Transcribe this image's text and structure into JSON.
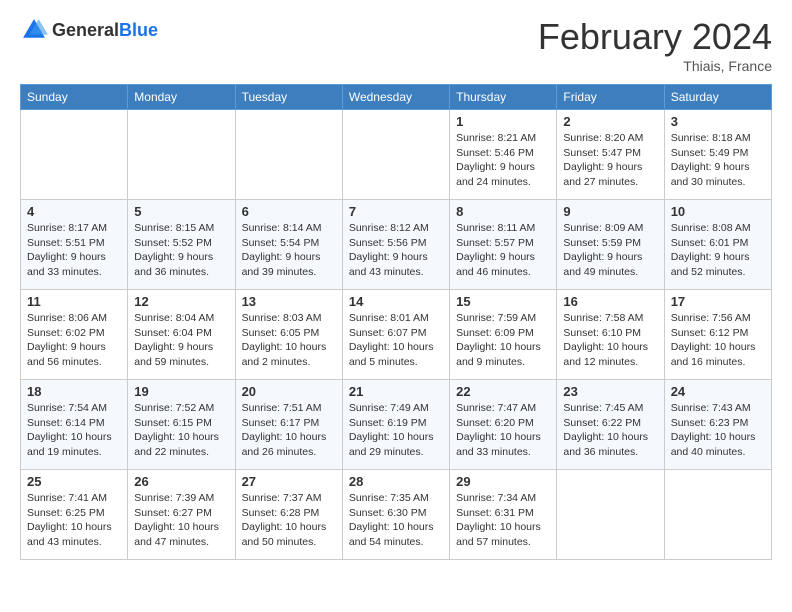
{
  "header": {
    "logo_general": "General",
    "logo_blue": "Blue",
    "month_title": "February 2024",
    "location": "Thiais, France"
  },
  "weekdays": [
    "Sunday",
    "Monday",
    "Tuesday",
    "Wednesday",
    "Thursday",
    "Friday",
    "Saturday"
  ],
  "weeks": [
    [
      {
        "day": "",
        "info": ""
      },
      {
        "day": "",
        "info": ""
      },
      {
        "day": "",
        "info": ""
      },
      {
        "day": "",
        "info": ""
      },
      {
        "day": "1",
        "info": "Sunrise: 8:21 AM\nSunset: 5:46 PM\nDaylight: 9 hours\nand 24 minutes."
      },
      {
        "day": "2",
        "info": "Sunrise: 8:20 AM\nSunset: 5:47 PM\nDaylight: 9 hours\nand 27 minutes."
      },
      {
        "day": "3",
        "info": "Sunrise: 8:18 AM\nSunset: 5:49 PM\nDaylight: 9 hours\nand 30 minutes."
      }
    ],
    [
      {
        "day": "4",
        "info": "Sunrise: 8:17 AM\nSunset: 5:51 PM\nDaylight: 9 hours\nand 33 minutes."
      },
      {
        "day": "5",
        "info": "Sunrise: 8:15 AM\nSunset: 5:52 PM\nDaylight: 9 hours\nand 36 minutes."
      },
      {
        "day": "6",
        "info": "Sunrise: 8:14 AM\nSunset: 5:54 PM\nDaylight: 9 hours\nand 39 minutes."
      },
      {
        "day": "7",
        "info": "Sunrise: 8:12 AM\nSunset: 5:56 PM\nDaylight: 9 hours\nand 43 minutes."
      },
      {
        "day": "8",
        "info": "Sunrise: 8:11 AM\nSunset: 5:57 PM\nDaylight: 9 hours\nand 46 minutes."
      },
      {
        "day": "9",
        "info": "Sunrise: 8:09 AM\nSunset: 5:59 PM\nDaylight: 9 hours\nand 49 minutes."
      },
      {
        "day": "10",
        "info": "Sunrise: 8:08 AM\nSunset: 6:01 PM\nDaylight: 9 hours\nand 52 minutes."
      }
    ],
    [
      {
        "day": "11",
        "info": "Sunrise: 8:06 AM\nSunset: 6:02 PM\nDaylight: 9 hours\nand 56 minutes."
      },
      {
        "day": "12",
        "info": "Sunrise: 8:04 AM\nSunset: 6:04 PM\nDaylight: 9 hours\nand 59 minutes."
      },
      {
        "day": "13",
        "info": "Sunrise: 8:03 AM\nSunset: 6:05 PM\nDaylight: 10 hours\nand 2 minutes."
      },
      {
        "day": "14",
        "info": "Sunrise: 8:01 AM\nSunset: 6:07 PM\nDaylight: 10 hours\nand 5 minutes."
      },
      {
        "day": "15",
        "info": "Sunrise: 7:59 AM\nSunset: 6:09 PM\nDaylight: 10 hours\nand 9 minutes."
      },
      {
        "day": "16",
        "info": "Sunrise: 7:58 AM\nSunset: 6:10 PM\nDaylight: 10 hours\nand 12 minutes."
      },
      {
        "day": "17",
        "info": "Sunrise: 7:56 AM\nSunset: 6:12 PM\nDaylight: 10 hours\nand 16 minutes."
      }
    ],
    [
      {
        "day": "18",
        "info": "Sunrise: 7:54 AM\nSunset: 6:14 PM\nDaylight: 10 hours\nand 19 minutes."
      },
      {
        "day": "19",
        "info": "Sunrise: 7:52 AM\nSunset: 6:15 PM\nDaylight: 10 hours\nand 22 minutes."
      },
      {
        "day": "20",
        "info": "Sunrise: 7:51 AM\nSunset: 6:17 PM\nDaylight: 10 hours\nand 26 minutes."
      },
      {
        "day": "21",
        "info": "Sunrise: 7:49 AM\nSunset: 6:19 PM\nDaylight: 10 hours\nand 29 minutes."
      },
      {
        "day": "22",
        "info": "Sunrise: 7:47 AM\nSunset: 6:20 PM\nDaylight: 10 hours\nand 33 minutes."
      },
      {
        "day": "23",
        "info": "Sunrise: 7:45 AM\nSunset: 6:22 PM\nDaylight: 10 hours\nand 36 minutes."
      },
      {
        "day": "24",
        "info": "Sunrise: 7:43 AM\nSunset: 6:23 PM\nDaylight: 10 hours\nand 40 minutes."
      }
    ],
    [
      {
        "day": "25",
        "info": "Sunrise: 7:41 AM\nSunset: 6:25 PM\nDaylight: 10 hours\nand 43 minutes."
      },
      {
        "day": "26",
        "info": "Sunrise: 7:39 AM\nSunset: 6:27 PM\nDaylight: 10 hours\nand 47 minutes."
      },
      {
        "day": "27",
        "info": "Sunrise: 7:37 AM\nSunset: 6:28 PM\nDaylight: 10 hours\nand 50 minutes."
      },
      {
        "day": "28",
        "info": "Sunrise: 7:35 AM\nSunset: 6:30 PM\nDaylight: 10 hours\nand 54 minutes."
      },
      {
        "day": "29",
        "info": "Sunrise: 7:34 AM\nSunset: 6:31 PM\nDaylight: 10 hours\nand 57 minutes."
      },
      {
        "day": "",
        "info": ""
      },
      {
        "day": "",
        "info": ""
      }
    ]
  ]
}
